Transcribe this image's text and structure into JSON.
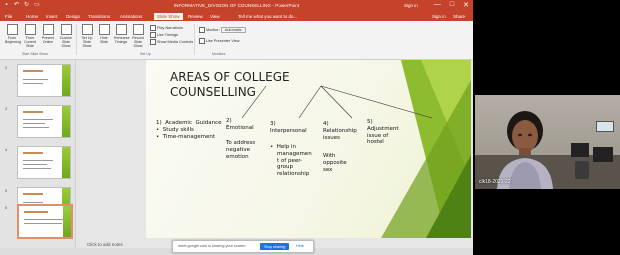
{
  "window": {
    "title": "INFORMATIVE_DIVISION OF COUNSELLING - PowerPoint",
    "sign_in": "Sign in",
    "controls": [
      "—",
      "□",
      "✕"
    ]
  },
  "tabs": [
    {
      "label": "File"
    },
    {
      "label": "Home"
    },
    {
      "label": "Insert"
    },
    {
      "label": "Design"
    },
    {
      "label": "Transitions"
    },
    {
      "label": "Animations"
    },
    {
      "label": "Slide Show",
      "active": true
    },
    {
      "label": "Review"
    },
    {
      "label": "View"
    }
  ],
  "tell_me": "Tell me what you want to do...",
  "share": "Share",
  "ribbon": {
    "buttons": [
      {
        "label": "From Beginning",
        "icon": "play-from-start-icon"
      },
      {
        "label": "From Current Slide",
        "icon": "play-current-icon"
      },
      {
        "label": "Present Online",
        "icon": "present-online-icon"
      },
      {
        "label": "Custom Slide Show",
        "icon": "custom-show-icon"
      },
      {
        "label": "Set Up Slide Show",
        "icon": "setup-icon"
      },
      {
        "label": "Hide Slide",
        "icon": "hide-slide-icon"
      },
      {
        "label": "Rehearse Timings",
        "icon": "rehearse-icon"
      },
      {
        "label": "Record Slide Show",
        "icon": "record-icon"
      }
    ],
    "checks": [
      "Play Narrations",
      "Use Timings",
      "Show Media Controls"
    ],
    "monitor_label": "Monitor:",
    "monitor_value": "Automatic",
    "presenter_view": "Use Presenter View",
    "groups": [
      "Start Slide Show",
      "Set Up",
      "Monitors"
    ]
  },
  "thumbnails": [
    {
      "number": "2"
    },
    {
      "number": "3"
    },
    {
      "number": "4"
    },
    {
      "number": "5"
    },
    {
      "number": "6",
      "selected": true
    }
  ],
  "slide": {
    "title": "AREAS OF COLLEGE\nCOUNSELLING",
    "col1": "1)  Academic  Guidance\n•  Study skills\n•  Time-management",
    "col2": "2)\nEmotional",
    "col2b": "To address\nnegative\nemotion",
    "col3": "3)\nInterpersonal",
    "col3b": "•  Help in\n    managemen\n    t of peer-\n    group\n    relationship",
    "col4": "4)\nRelationship\nissues",
    "col4b": "With\nopposite\nsex",
    "col5": "5)\nAdjustment\nissue of\nhostel"
  },
  "notes_placeholder": "Click to add notes",
  "share_bar": {
    "message": "meet.google.com is sharing your screen.",
    "stop": "Stop sharing",
    "hide": "Hide"
  },
  "video": {
    "label": "clk18-2021-22"
  }
}
